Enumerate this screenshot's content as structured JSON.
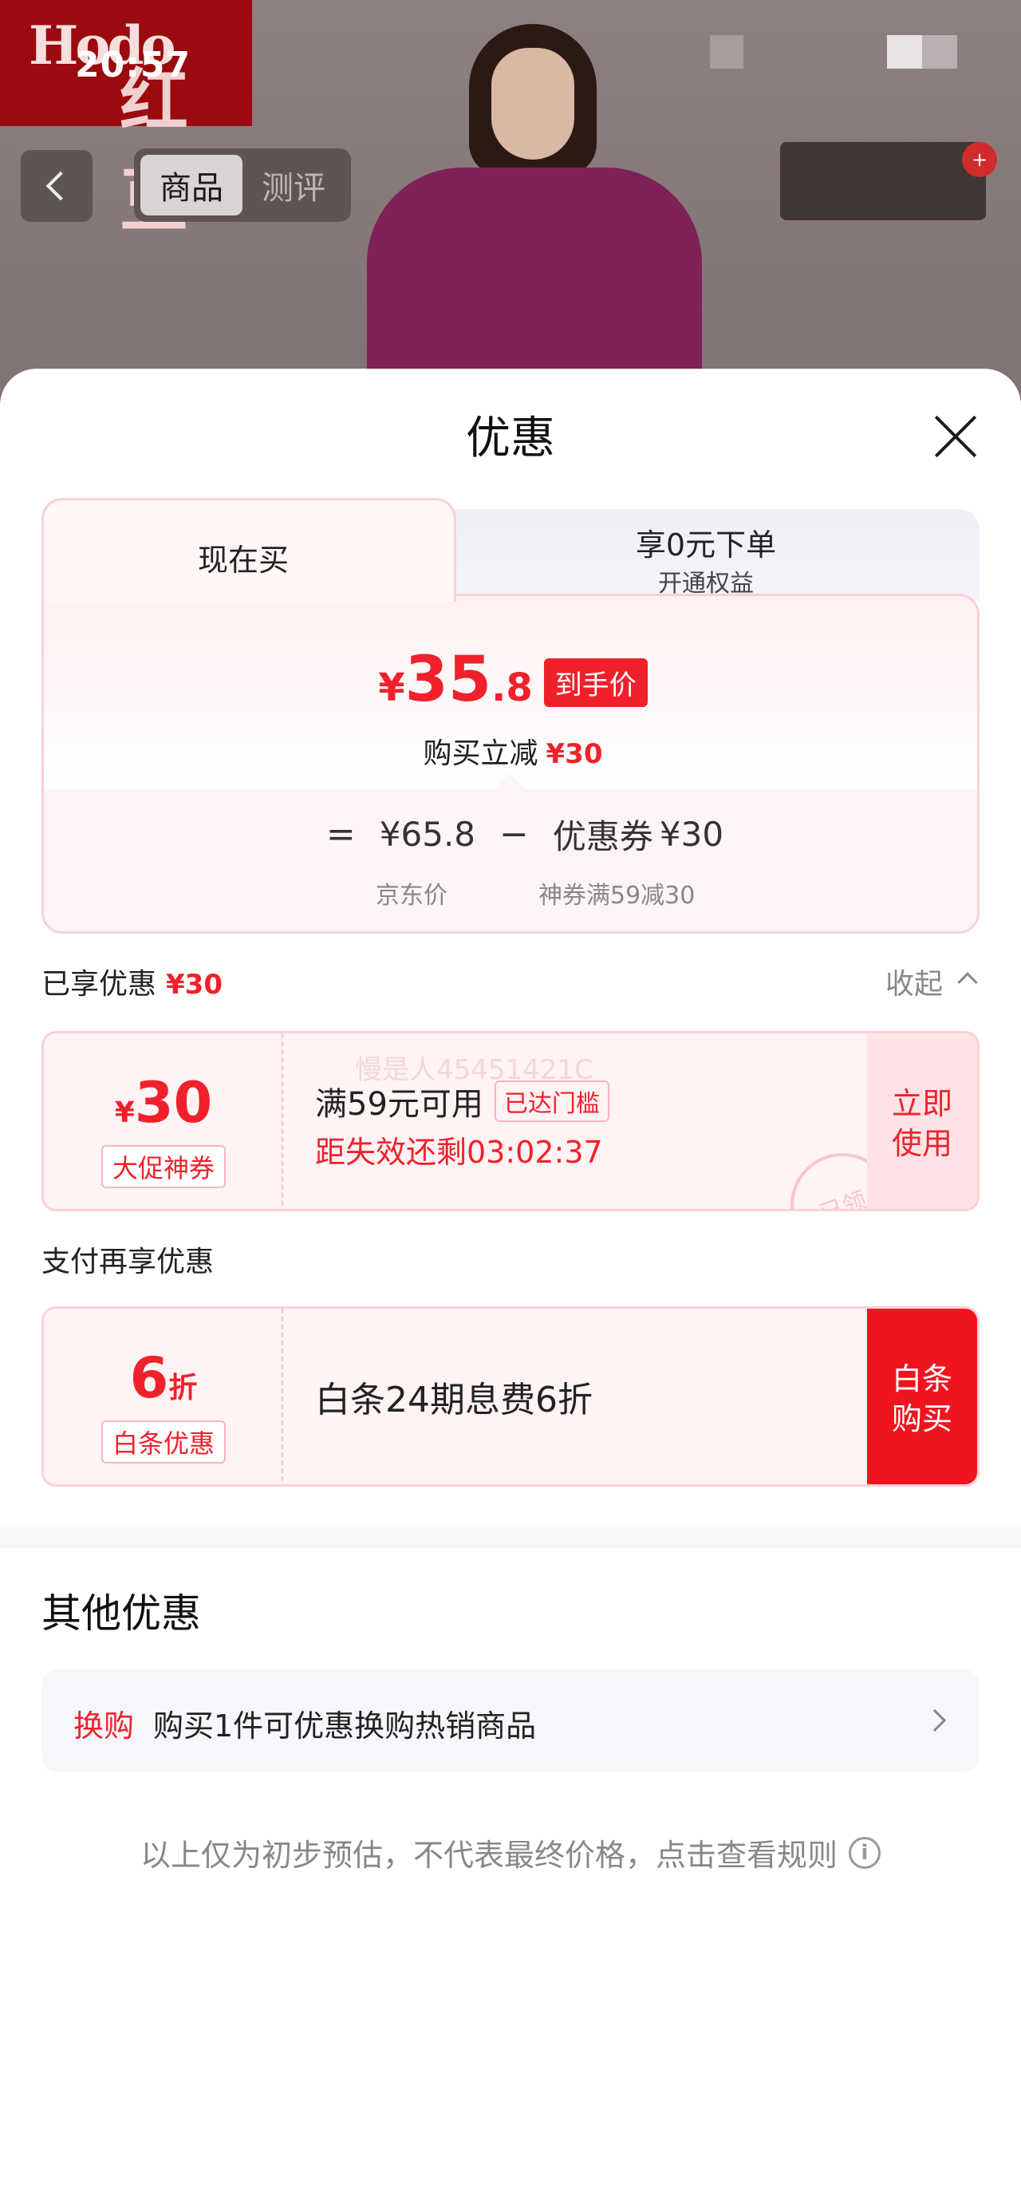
{
  "status_bar": {
    "time": "20:57"
  },
  "brand": {
    "logo_text": "Hodo",
    "logo_cn": "红豆"
  },
  "header": {
    "tabs": [
      "商品",
      "测评"
    ],
    "active_tab": "商品"
  },
  "sheet": {
    "title": "优惠",
    "price_tabs": {
      "now_label": "现在买",
      "alt_title": "享0元下单",
      "alt_sub": "开通权益"
    },
    "final_price": {
      "symbol": "¥",
      "integer": "35",
      "decimal": ".8",
      "tag": "到手价"
    },
    "reduction": {
      "label": "购买立减",
      "value": "¥30"
    },
    "formula": {
      "equals": "=",
      "jd_price": "¥65.8",
      "minus": "−",
      "coupon_label": "优惠券",
      "coupon_value": "¥30",
      "jd_price_caption": "京东价",
      "coupon_caption": "神券满59减30"
    },
    "enjoyed": {
      "title": "已享优惠",
      "amount": "¥30",
      "collapse_label": "收起"
    },
    "coupon": {
      "symbol": "¥",
      "amount": "30",
      "badge": "大促神券",
      "condition": "满59元可用",
      "status": "已达门槛",
      "expiry": "距失效还剩03:02:37",
      "action": "立即使用",
      "stamp": "已领",
      "watermark": "慢是人45451421C"
    },
    "pay_section": {
      "title": "支付再享优惠",
      "discount_num": "6",
      "discount_unit": "折",
      "badge": "白条优惠",
      "description": "白条24期息费6折",
      "action": "白条购买"
    },
    "other": {
      "title": "其他优惠",
      "swap_tag": "换购",
      "swap_text": "购买1件可优惠换购热销商品"
    },
    "footnote": "以上仅为初步预估，不代表最终价格，点击查看规则",
    "info_icon_glyph": "i"
  },
  "colors": {
    "accent": "#f0212c",
    "brand_red": "#9a0a0e"
  }
}
